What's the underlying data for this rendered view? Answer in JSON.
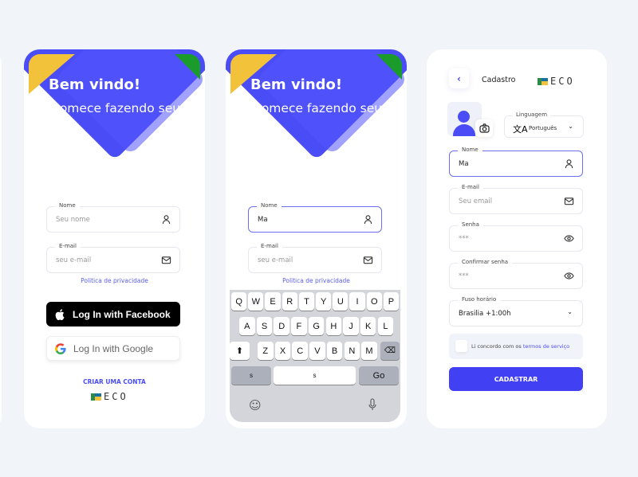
{
  "colors": {
    "primary": "#4a4cf6",
    "yellow": "#f2c23a",
    "green": "#1a9b2b",
    "background": "#f1f4f9"
  },
  "login": {
    "welcome": "Bem vindo!",
    "subtitle": "Comece fazendo seu login",
    "name_label": "Nome",
    "name_placeholder": "Seu nome",
    "email_label": "E-mail",
    "email_placeholder": "seu e-mail",
    "privacy": "Politica de privacidade",
    "facebook": "Log In with Facebook",
    "google": "Log In with Google",
    "create_account": "CRIAR UMA CONTA",
    "logo": "ECO"
  },
  "login_typing": {
    "welcome": "Bem vindo!",
    "subtitle": "Comece fazendo seu login",
    "name_label": "Nome",
    "name_value": "Ma",
    "email_label": "E-mail",
    "email_placeholder": "seu e-mail",
    "privacy": "Politica de privacidade",
    "keyboard": {
      "row1": [
        "Q",
        "W",
        "E",
        "R",
        "T",
        "Y",
        "U",
        "I",
        "O",
        "P"
      ],
      "row2": [
        "A",
        "S",
        "D",
        "F",
        "G",
        "H",
        "J",
        "K",
        "L"
      ],
      "row3": [
        "Z",
        "X",
        "C",
        "V",
        "B",
        "N",
        "M"
      ],
      "left": "s",
      "space": "s",
      "go": "Go"
    }
  },
  "signup": {
    "title": "Cadastro",
    "logo": "ECO",
    "language_label": "Linguagem",
    "language_value": "Português",
    "name_label": "Nome",
    "name_value": "Ma",
    "email_label": "E-mail",
    "email_placeholder": "Seu email",
    "password_label": "Senha",
    "password_value": "***",
    "confirm_label": "Confirmar senha",
    "confirm_value": "***",
    "timezone_label": "Fuso horário",
    "timezone_value": "Brasilia +1:00h",
    "terms_prefix": "Li concordo com os ",
    "terms_link": "termos de serviço",
    "submit": "CADASTRAR"
  }
}
